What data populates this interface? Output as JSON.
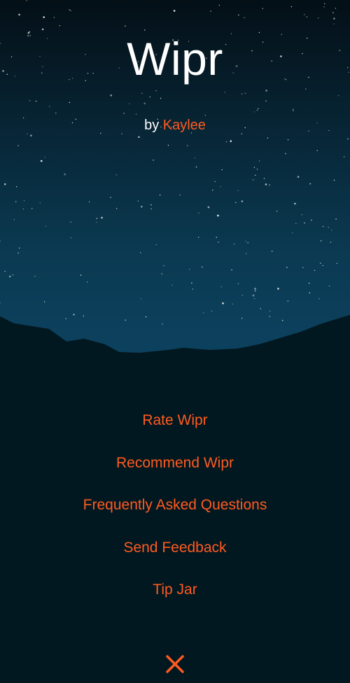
{
  "app": {
    "title": "Wipr",
    "byline_prefix": "by",
    "author": "Kaylee"
  },
  "menu": {
    "items": [
      {
        "label": "Rate Wipr"
      },
      {
        "label": "Recommend Wipr"
      },
      {
        "label": "Frequently Asked Questions"
      },
      {
        "label": "Send Feedback"
      },
      {
        "label": "Tip Jar"
      }
    ]
  },
  "close": {
    "icon": "close-icon"
  },
  "colors": {
    "accent": "#ff5a1f",
    "background": "#021820",
    "sky_top": "#040f16",
    "sky_bottom": "#0c4260",
    "text": "#ffffff"
  }
}
